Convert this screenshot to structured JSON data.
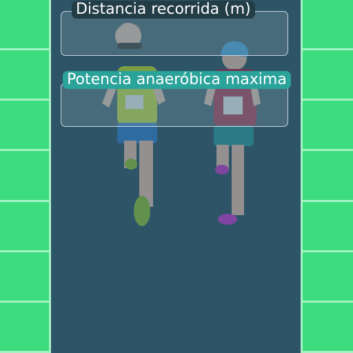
{
  "background": {
    "track_color": "#2d5467",
    "grass_color": "#3ddc7e",
    "line_color": "#a6f2c4"
  },
  "form": {
    "distance_label": "Distancia recorrida (m)",
    "distance_value": "",
    "power_label": "Potencia anaeróbica maxima",
    "power_value": ""
  },
  "illustration": {
    "icon": "runners-image"
  }
}
